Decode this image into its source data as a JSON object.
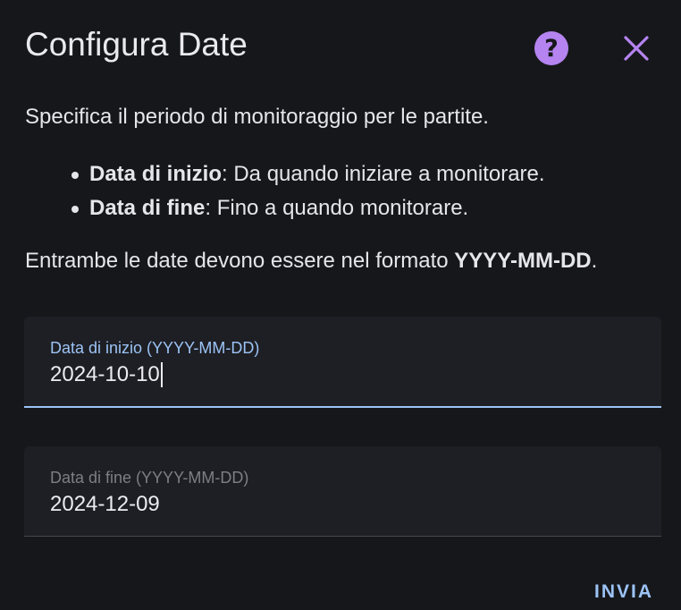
{
  "dialog": {
    "title": "Configura Date",
    "help_icon": "help-circle-icon",
    "help_glyph": "?",
    "close_icon": "close-icon"
  },
  "content": {
    "intro": "Specifica il periodo di monitoraggio per le partite.",
    "bullets": [
      {
        "term": "Data di inizio",
        "description": ": Da quando iniziare a monitorare."
      },
      {
        "term": "Data di fine",
        "description": ": Fino a quando monitorare."
      }
    ],
    "format_prefix": "Entrambe le date devono essere nel formato ",
    "format_value": "YYYY-MM-DD",
    "format_suffix": "."
  },
  "fields": {
    "start": {
      "label": "Data di inizio (YYYY-MM-DD)",
      "value": "2024-10-10",
      "focused": true
    },
    "end": {
      "label": "Data di fine (YYYY-MM-DD)",
      "value": "2024-12-09",
      "focused": false
    }
  },
  "actions": {
    "submit_label": "INVIA"
  },
  "colors": {
    "background": "#16171b",
    "accent_purple": "#b584f0",
    "accent_blue": "#9cc3f5",
    "field_background": "#1e1f24"
  }
}
